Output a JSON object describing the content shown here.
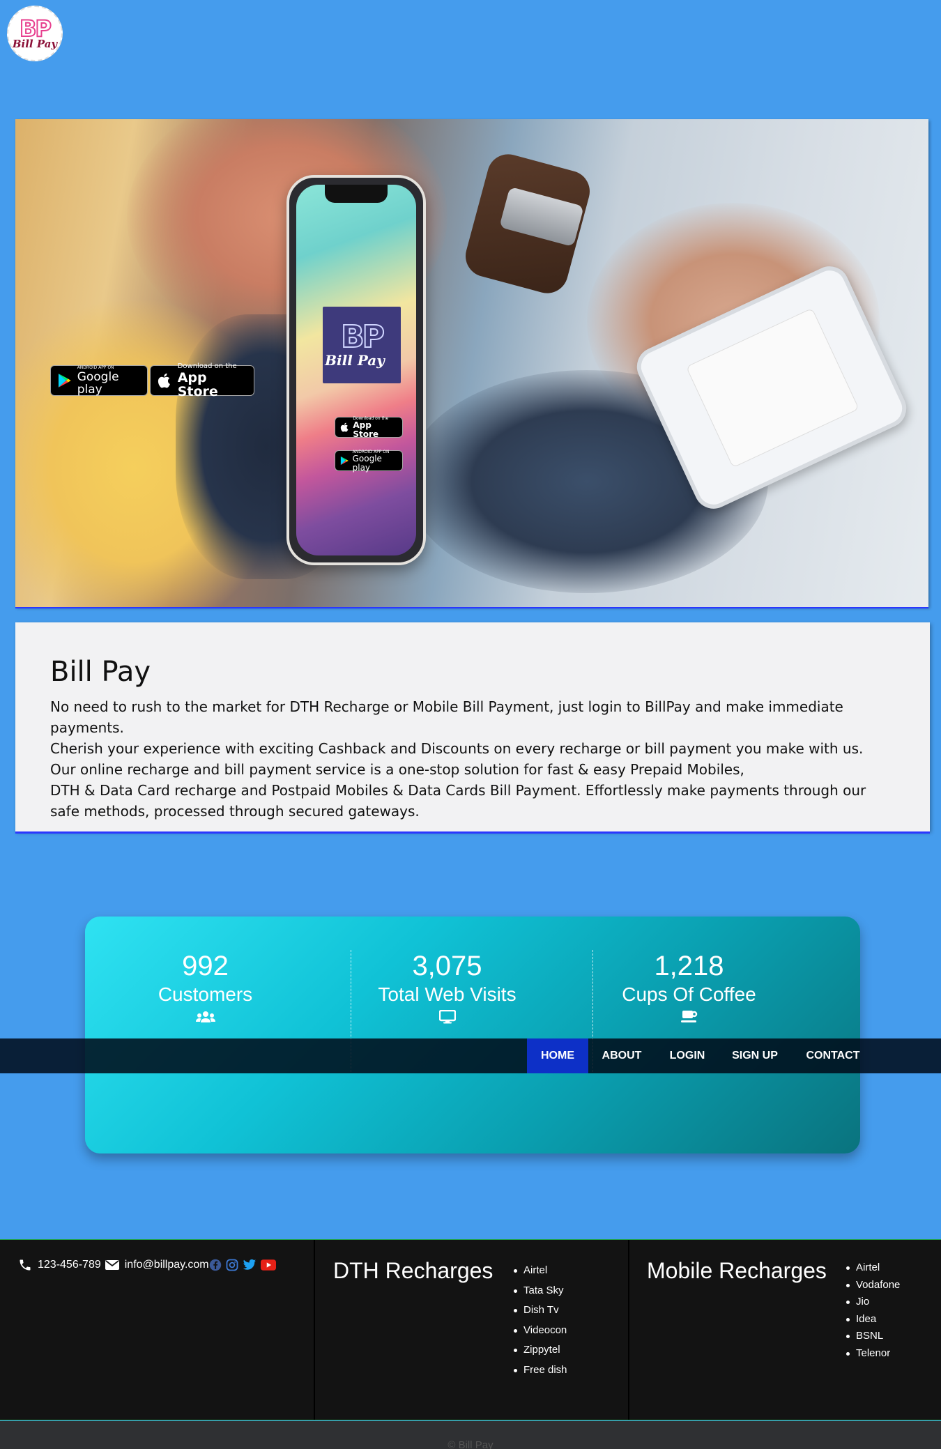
{
  "logo": {
    "mark": "BP",
    "text": "Bill Pay"
  },
  "hero": {
    "badges": {
      "google_small": "ANDROID APP ON",
      "google_big": "Google play",
      "apple_small": "Download on the",
      "apple_big": "App Store"
    }
  },
  "about": {
    "title": "Bill Pay",
    "lines": [
      "No need to rush to the market for DTH Recharge or Mobile Bill Payment, just login to BillPay and make immediate payments.",
      "Cherish your experience with exciting Cashback and Discounts on every recharge or bill payment you make with us.",
      "Our online recharge and bill payment service is a one-stop solution for fast & easy Prepaid Mobiles,",
      "DTH & Data Card recharge and Postpaid Mobiles & Data Cards Bill Payment. Effortlessly make payments through our safe methods, processed through secured gateways."
    ]
  },
  "stats": [
    {
      "value": "992",
      "label": "Customers",
      "icon": "users-icon"
    },
    {
      "value": "3,075",
      "label": "Total Web Visits",
      "icon": "desktop-icon"
    },
    {
      "value": "1,218",
      "label": "Cups Of Coffee",
      "icon": "coffee-icon"
    }
  ],
  "nav": {
    "items": [
      "HOME",
      "ABOUT",
      "LOGIN",
      "SIGN UP",
      "CONTACT"
    ],
    "active": "HOME",
    "active_color": "#0d30c7"
  },
  "footer": {
    "phone": "123-456-789",
    "email": "info@billpay.com",
    "social": [
      "facebook-icon",
      "instagram-icon",
      "twitter-icon",
      "youtube-icon"
    ],
    "dth": {
      "title": "DTH Recharges",
      "items": [
        "Airtel",
        "Tata Sky",
        "Dish Tv",
        "Videocon",
        "Zippytel",
        "Free dish"
      ]
    },
    "mobile": {
      "title": "Mobile Recharges",
      "items": [
        "Airtel",
        "Vodafone",
        "Jio",
        "Idea",
        "BSNL",
        "Telenor"
      ]
    },
    "copyright": "© Bill Pay"
  },
  "colors": {
    "page_bg": "#459ced",
    "footer_bg": "#131313",
    "stats_gradient_start": "#2fe2f2",
    "stats_gradient_end": "#0a737e",
    "logo_pink": "#e7408f"
  }
}
